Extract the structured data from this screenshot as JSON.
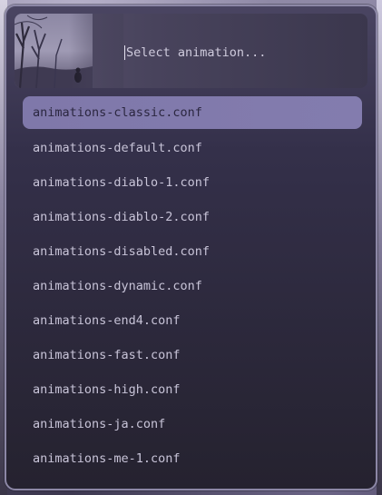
{
  "search": {
    "placeholder": "Select animation..."
  },
  "items": [
    {
      "label": "animations-classic.conf",
      "selected": true
    },
    {
      "label": "animations-default.conf"
    },
    {
      "label": "animations-diablo-1.conf"
    },
    {
      "label": "animations-diablo-2.conf"
    },
    {
      "label": "animations-disabled.conf"
    },
    {
      "label": "animations-dynamic.conf"
    },
    {
      "label": "animations-end4.conf"
    },
    {
      "label": "animations-fast.conf"
    },
    {
      "label": "animations-high.conf"
    },
    {
      "label": "animations-ja.conf"
    },
    {
      "label": "animations-me-1.conf"
    }
  ],
  "colors": {
    "accent": "#7f78aa",
    "border": "#8c87a6",
    "text": "#c8c4d8",
    "selected_text": "#2b2740"
  }
}
